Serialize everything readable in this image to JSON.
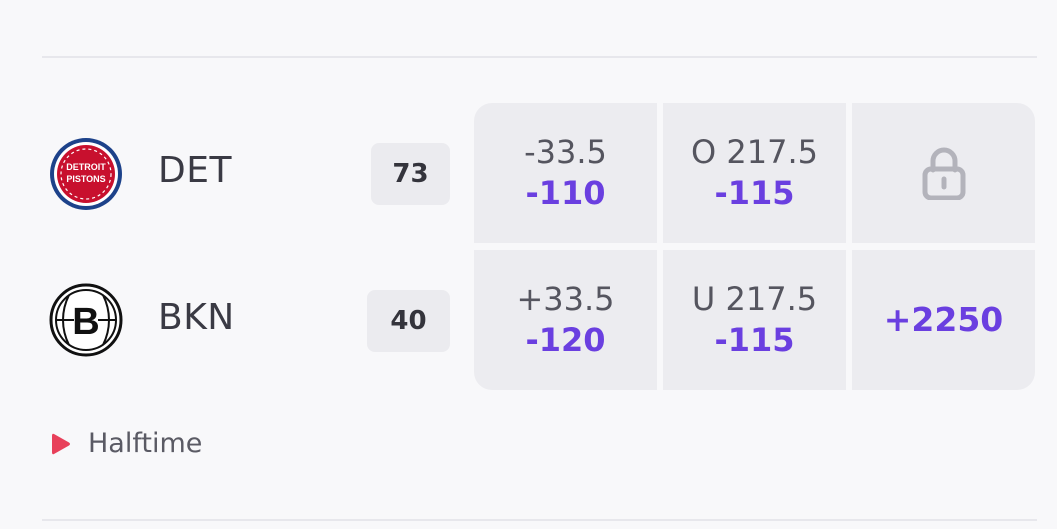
{
  "teams": [
    {
      "abbr": "DET",
      "logo": "pistons-logo",
      "logo_text_1": "DETROIT",
      "logo_text_2": "PISTONS",
      "score": "73",
      "spread": {
        "line": "-33.5",
        "price": "-110"
      },
      "total": {
        "line": "O 217.5",
        "price": "-115"
      },
      "moneyline": {
        "locked": true,
        "icon": "lock-icon"
      }
    },
    {
      "abbr": "BKN",
      "logo": "nets-logo",
      "logo_text_1": "B",
      "score": "40",
      "spread": {
        "line": "+33.5",
        "price": "-120"
      },
      "total": {
        "line": "U 217.5",
        "price": "-115"
      },
      "moneyline": {
        "price": "+2250"
      }
    }
  ],
  "status": {
    "icon": "live-play-icon",
    "label": "Halftime"
  },
  "colors": {
    "accent": "#6a3fe0",
    "live": "#e8405a",
    "cell_bg": "#ececf0",
    "page_bg": "#f8f8fa"
  }
}
